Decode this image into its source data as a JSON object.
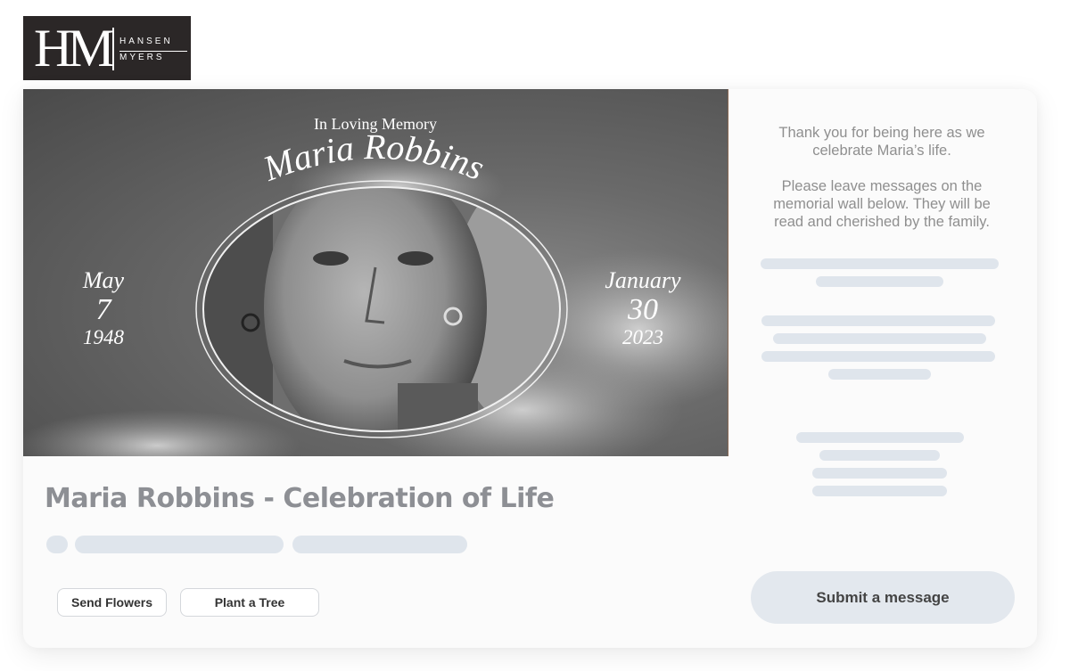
{
  "logo": {
    "monogram": "HM",
    "line1": "HANSEN",
    "line2": "MYERS"
  },
  "hero": {
    "tagline": "In Loving Memory",
    "name": "Maria Robbins",
    "birth": {
      "month": "May",
      "day": "7",
      "year": "1948"
    },
    "death": {
      "month": "January",
      "day": "30",
      "year": "2023"
    },
    "photo_icon": "portrait-photo"
  },
  "page": {
    "title": "Maria Robbins - Celebration of Life"
  },
  "actions": {
    "send_flowers": "Send Flowers",
    "plant_tree": "Plant a Tree"
  },
  "side": {
    "intro": "Thank you for being here as we celebrate Maria’s life.",
    "instructions": "Please leave messages on the memorial wall below. They will be read and cherished by the family.",
    "submit_label": "Submit a message"
  },
  "colors": {
    "skeleton": "#dfe5ec",
    "title": "#8d8f94",
    "submit_bg": "#e3e8ee",
    "logo_bg": "#2b2727"
  }
}
